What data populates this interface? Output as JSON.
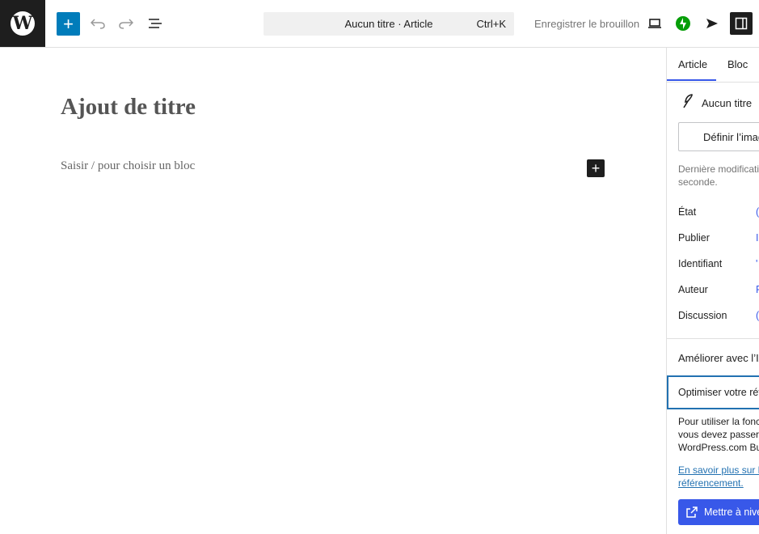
{
  "toolbar": {
    "logo_glyph": "W",
    "add_block_label": "+",
    "command_title": "Aucun titre · Article",
    "command_shortcut": "Ctrl+K",
    "save_draft_label": "Enregistrer le brouillon",
    "icons": [
      "wordpress-logo",
      "add-block-icon",
      "undo-icon",
      "redo-icon",
      "document-overview-icon",
      "preview-desktop-icon",
      "jetpack-icon",
      "publish-send-icon",
      "settings-sidebar-icon"
    ],
    "accent_color": "#007cba",
    "jetpack_color": "#069e08"
  },
  "editor": {
    "title_placeholder": "Ajout de titre",
    "block_placeholder": "Saisir / pour choisir un bloc",
    "block_add_label": "+"
  },
  "sidebar": {
    "tabs": [
      {
        "label": "Article",
        "active": true
      },
      {
        "label": "Bloc",
        "active": false
      }
    ],
    "post_title": "Aucun titre",
    "featured_image_label": "Définir l’image",
    "last_modified": "Dernière modification seconde.",
    "fields": [
      {
        "label": "État",
        "value": "("
      },
      {
        "label": "Publier",
        "value": "I"
      },
      {
        "label": "Identifiant",
        "value": "'"
      },
      {
        "label": "Auteur",
        "value": "F"
      },
      {
        "label": "Discussion",
        "value": "("
      }
    ],
    "ai_section_label": "Améliorer avec l’IA",
    "seo_label": "Optimiser votre réfé",
    "seo_description": "Pour utiliser la fonct vous devez passer a WordPress.com Bus",
    "learn_more_link": "En savoir plus sur la référencement.",
    "upgrade_label": "Mettre à nive"
  }
}
